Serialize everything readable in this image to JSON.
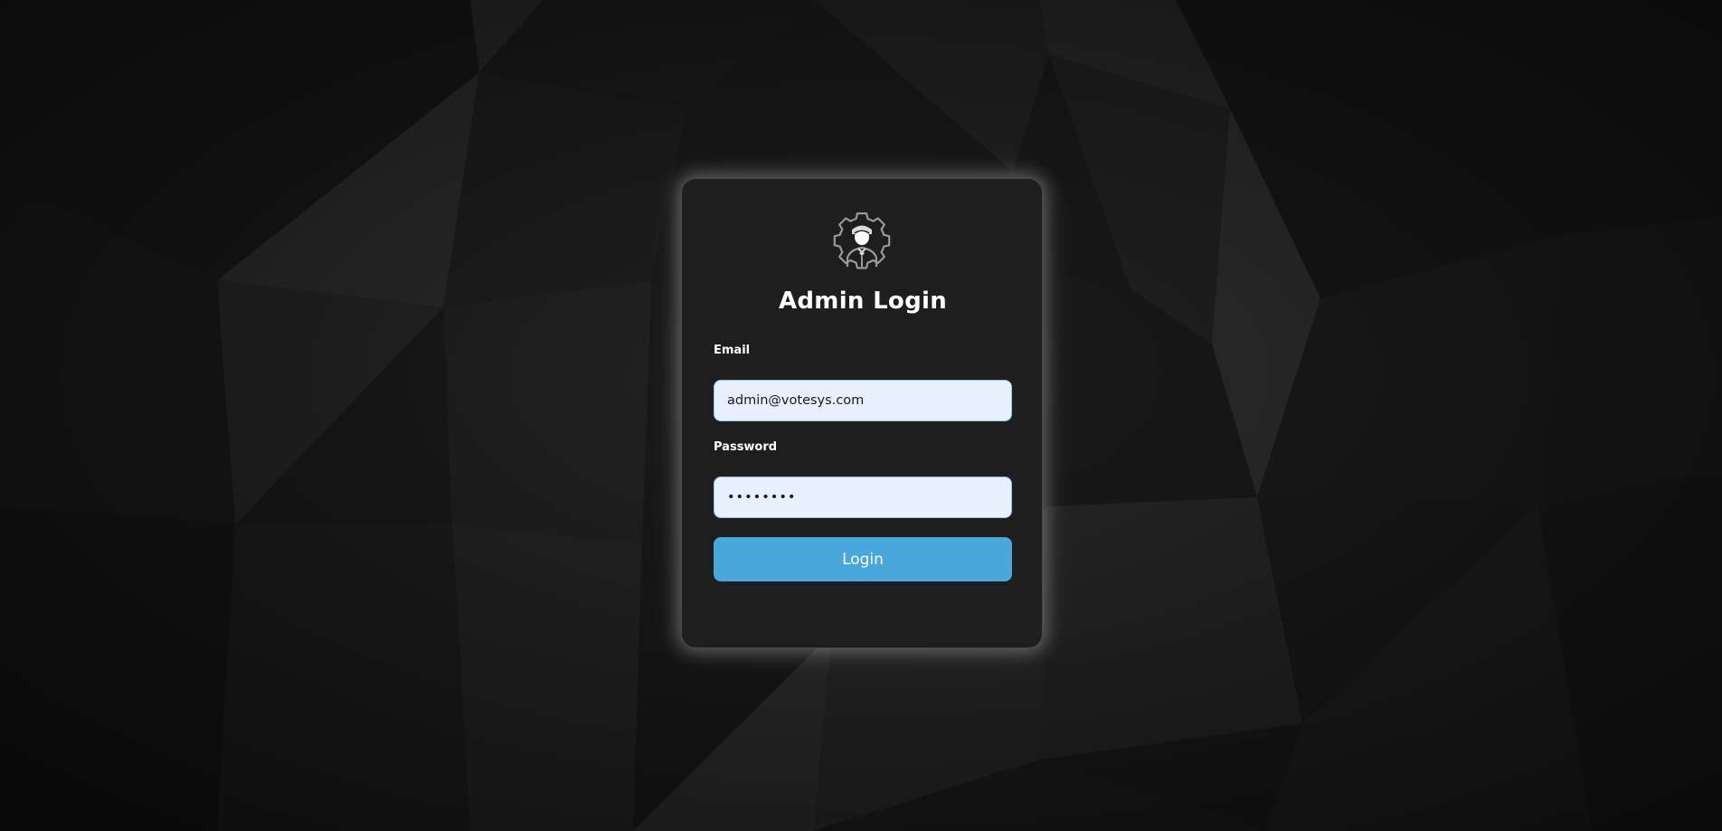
{
  "page": {
    "title": "Admin Login"
  },
  "form": {
    "logo_icon": "admin-gear-person-icon",
    "email_label": "Email",
    "email_value": "admin@votesys.com",
    "password_label": "Password",
    "password_value": "••••••••",
    "login_label": "Login"
  },
  "colors": {
    "background": "#161616",
    "card": "#1e1e1e",
    "input_bg": "#e8f0fe",
    "input_border": "#8fc3e9",
    "button": "#4aa7dc",
    "text": "#ffffff"
  }
}
